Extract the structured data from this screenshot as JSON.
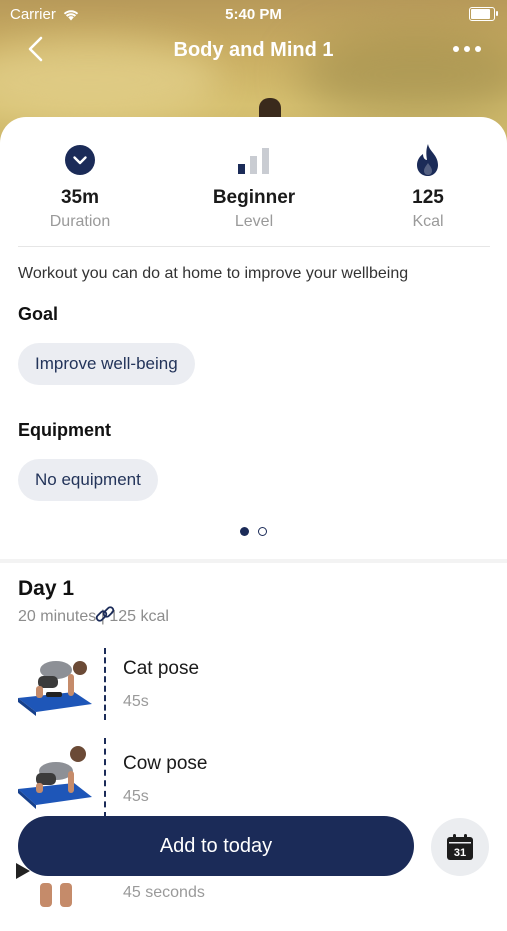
{
  "status_bar": {
    "carrier": "Carrier",
    "time": "5:40 PM"
  },
  "nav": {
    "title": "Body and Mind 1"
  },
  "stats": [
    {
      "value": "35m",
      "label": "Duration",
      "icon": "clock-icon"
    },
    {
      "value": "Beginner",
      "label": "Level",
      "icon": "level-bars-icon"
    },
    {
      "value": "125",
      "label": "Kcal",
      "icon": "flame-icon"
    }
  ],
  "description": "Workout you can do at home to improve your wellbeing",
  "goal": {
    "title": "Goal",
    "chip": "Improve well-being"
  },
  "equipment": {
    "title": "Equipment",
    "chip": "No equipment"
  },
  "pager": {
    "pages": 2,
    "active": 0
  },
  "day": {
    "title": "Day 1",
    "subtitle": "20 minutes | 125 kcal",
    "exercises": [
      {
        "name": "Cat pose",
        "duration": "45s"
      },
      {
        "name": "Cow pose",
        "duration": "45s"
      },
      {
        "name": "",
        "duration": "45 seconds"
      }
    ]
  },
  "cta": {
    "label": "Add to today"
  },
  "calendar_button": {
    "day": "31"
  },
  "colors": {
    "primary": "#1b2b58",
    "chip_bg": "#ebedf2",
    "muted_text": "#9a9a9a"
  }
}
